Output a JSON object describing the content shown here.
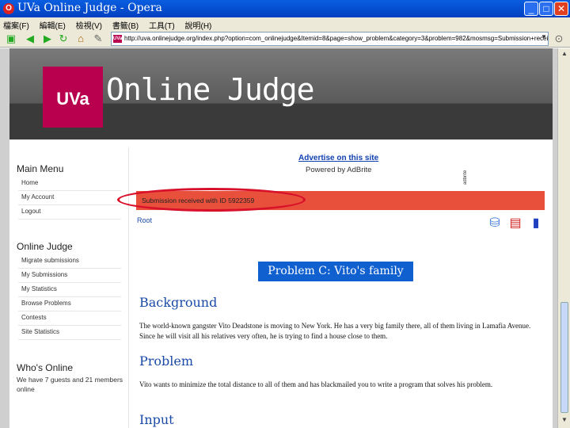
{
  "window": {
    "title": "UVa Online Judge - Opera",
    "min": "_",
    "max": "□",
    "close": "✕",
    "app_icon": "O"
  },
  "menubar": [
    "檔案(F)",
    "編輯(E)",
    "檢視(V)",
    "書籤(B)",
    "工具(T)",
    "說明(H)"
  ],
  "address": {
    "url": "http://uva.onlinejudge.org/index.php?option=com_onlinejudge&Itemid=8&page=show_problem&category=3&problem=982&mosmsg=Submission+received+with+ID+5922359",
    "favicon": "UVa"
  },
  "site": {
    "logo": "UVa",
    "title": "Online Judge"
  },
  "sidebar": {
    "main_menu": {
      "title": "Main Menu",
      "items": [
        "Home",
        "My Account",
        "Logout"
      ]
    },
    "online_judge": {
      "title": "Online Judge",
      "items": [
        "Migrate submissions",
        "My Submissions",
        "My Statistics",
        "Browse Problems",
        "Contests",
        "Site Statistics"
      ]
    },
    "whos_online": {
      "title": "Who's Online",
      "text": "We have 7 guests and 21 members online"
    }
  },
  "ad": {
    "link": "Advertise on this site",
    "powered": "Powered by AdBrite",
    "vertical": "adbrite"
  },
  "notice": "Submission received with ID 5922359",
  "breadcrumb": "Root",
  "problem": {
    "title": "Problem C: Vito's family",
    "sections": [
      {
        "head": "Background",
        "body": "The world-known gangster Vito Deadstone is moving to New York. He has a very big family there, all of them living in Lamafia Avenue. Since he will visit all his relatives very often, he is trying to find a house close to them."
      },
      {
        "head": "Problem",
        "body": "Vito wants to minimize the total distance to all of them and has blackmailed you to write a program that solves his problem."
      },
      {
        "head": "Input",
        "body": ""
      }
    ]
  },
  "icons": {
    "back": "back-arrow-icon",
    "forward": "forward-arrow-icon",
    "reload": "reload-icon",
    "home": "home-icon",
    "wand": "wand-icon"
  }
}
